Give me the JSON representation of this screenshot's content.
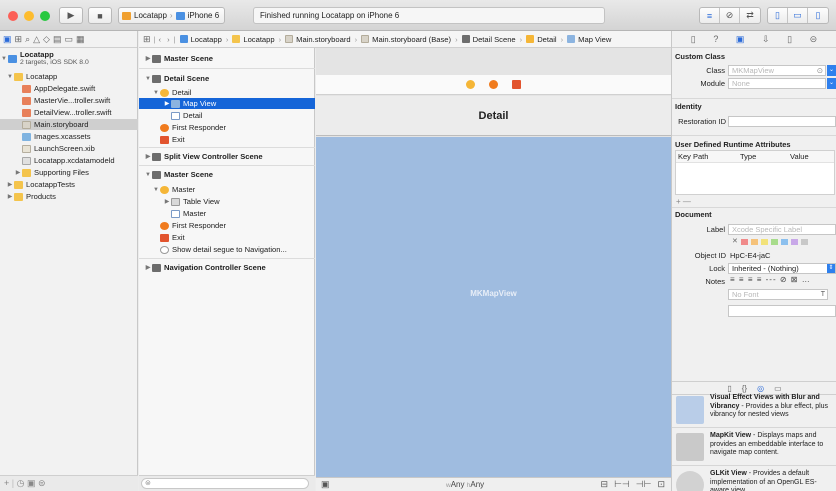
{
  "toolbar": {
    "scheme_app": "Locatapp",
    "scheme_device": "iPhone 6",
    "status_text": "Finished running Locatapp on iPhone 6"
  },
  "navigator": {
    "items": [
      {
        "label": "Locatapp",
        "sub": "2 targets, iOS SDK 8.0"
      },
      {
        "label": "Locatapp"
      },
      {
        "label": "AppDelegate.swift"
      },
      {
        "label": "MasterVie...troller.swift"
      },
      {
        "label": "DetailView...troller.swift"
      },
      {
        "label": "Main.storyboard"
      },
      {
        "label": "Images.xcassets"
      },
      {
        "label": "LaunchScreen.xib"
      },
      {
        "label": "Locatapp.xcdatamodeld"
      },
      {
        "label": "Supporting Files"
      },
      {
        "label": "LocatappTests"
      },
      {
        "label": "Products"
      }
    ]
  },
  "jumpbar": {
    "crumbs": [
      "Locatapp",
      "Locatapp",
      "Main.storyboard",
      "Main.storyboard (Base)",
      "Detail Scene",
      "Detail",
      "Map View"
    ]
  },
  "outline": {
    "rows": [
      "Master Scene",
      "Detail Scene",
      "Detail",
      "Map View",
      "Detail",
      "First Responder",
      "Exit",
      "Split View Controller Scene",
      "Master Scene",
      "Master",
      "Table View",
      "Master",
      "First Responder",
      "Exit",
      "Show detail segue to Navigation...",
      "Navigation Controller Scene"
    ]
  },
  "canvas": {
    "nav_title": "Detail",
    "mapview_label": "MKMapView",
    "size_w": "w",
    "size_w_val": "Any",
    "size_h": "h",
    "size_h_val": "Any"
  },
  "inspector": {
    "custom_class_head": "Custom Class",
    "class_label": "Class",
    "class_value": "MKMapView",
    "module_label": "Module",
    "module_value": "None",
    "identity_head": "Identity",
    "restoration_label": "Restoration ID",
    "udra_head": "User Defined Runtime Attributes",
    "col_keypath": "Key Path",
    "col_type": "Type",
    "col_value": "Value",
    "document_head": "Document",
    "doc_label_label": "Label",
    "doc_label_placeholder": "Xcode Specific Label",
    "object_id_label": "Object ID",
    "object_id_value": "HpC-E4-jaC",
    "lock_label": "Lock",
    "lock_value": "Inherited - (Nothing)",
    "notes_label": "Notes",
    "font_placeholder": "No Font",
    "library": [
      {
        "title": "Visual Effect Views with Blur and Vibrancy",
        "desc": " - Provides a blur effect, plus vibrancy for nested views"
      },
      {
        "title": "MapKit View",
        "desc": " - Displays maps and provides an embeddable interface to navigate map content."
      },
      {
        "title": "GLKit View",
        "desc": " - Provides a default implementation of an OpenGL ES-aware view."
      }
    ]
  },
  "colors": {
    "selection": "#1565d8",
    "mapview": "#9fbce0",
    "accent": "#2a6ad9"
  }
}
